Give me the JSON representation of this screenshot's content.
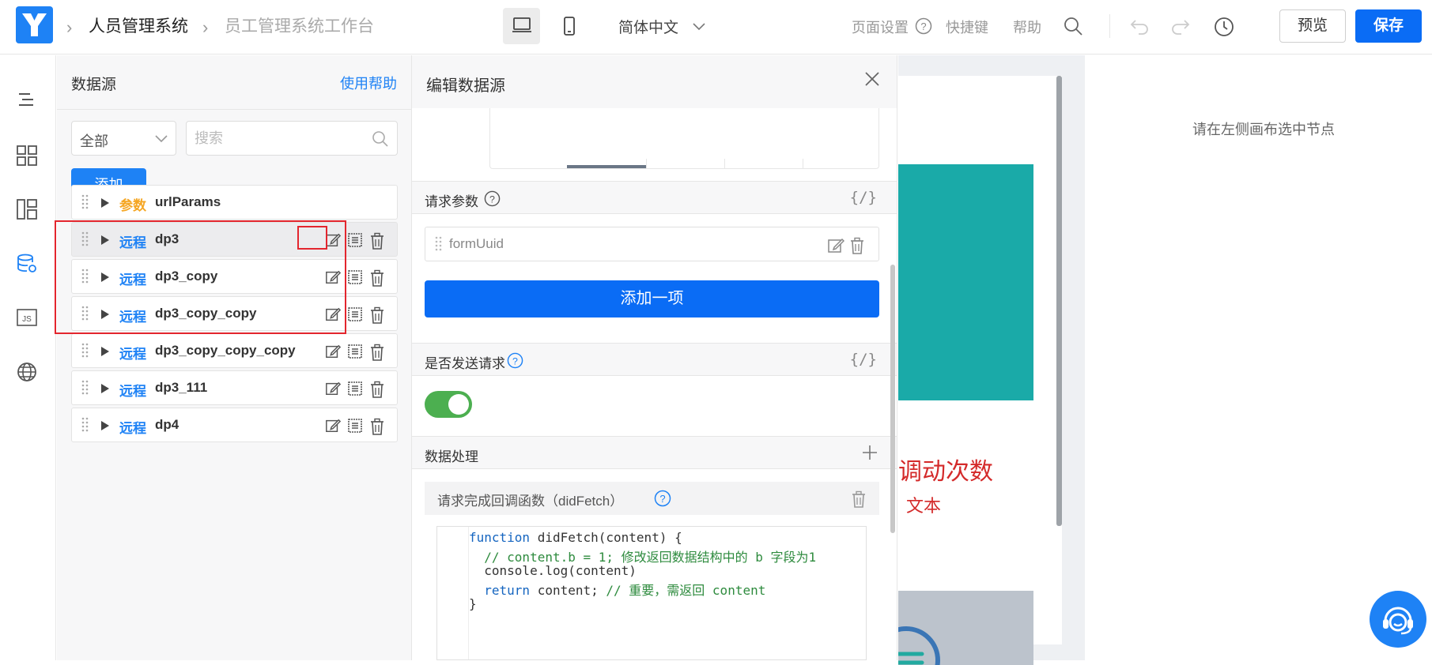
{
  "header": {
    "breadcrumb_app": "人员管理系统",
    "breadcrumb_page": "员工管理系统工作台",
    "language": "简体中文",
    "page_settings": "页面设置",
    "shortcuts": "快捷键",
    "help": "帮助",
    "preview_label": "预览",
    "save_label": "保存"
  },
  "rail": {
    "icons": [
      "outline-tree-icon",
      "components-grid-icon",
      "layout-icon",
      "datasource-icon",
      "js-code-icon",
      "globe-icon"
    ]
  },
  "datasource_panel": {
    "title": "数据源",
    "help_link": "使用帮助",
    "filter_value": "全部",
    "search_placeholder": "搜索",
    "add_label": "添加",
    "items": [
      {
        "kind": "参数",
        "name": "urlParams"
      },
      {
        "kind": "远程",
        "name": "dp3"
      },
      {
        "kind": "远程",
        "name": "dp3_copy"
      },
      {
        "kind": "远程",
        "name": "dp3_copy_copy"
      },
      {
        "kind": "远程",
        "name": "dp3_copy_copy_copy"
      },
      {
        "kind": "远程",
        "name": "dp3_111"
      },
      {
        "kind": "远程",
        "name": "dp4"
      }
    ]
  },
  "edit_panel": {
    "title": "编辑数据源",
    "request_params_title": "请求参数",
    "code_toggle": "{/}",
    "param_name": "formUuid",
    "add_item_label": "添加一项",
    "send_request_title": "是否发送请求",
    "send_request_enabled": true,
    "data_processing_title": "数据处理",
    "callback_title": "请求完成回调函数（didFetch）",
    "code_lines": [
      "function didFetch(content) {",
      "  // content.b = 1; 修改返回数据结构中的 b 字段为1",
      "  console.log(content)",
      "  return content; // 重要，需返回 content",
      "}"
    ]
  },
  "canvas": {
    "counter_text": "调动次数",
    "small_text": "文本"
  },
  "properties": {
    "hint": "请在左侧画布选中节点"
  },
  "colors": {
    "primary": "#0a6cf5",
    "link": "#1e82f5",
    "param_kind": "#f5a623",
    "teal": "#1aaaa8",
    "highlight_red": "#e3262e",
    "toggle_on": "#4caf50"
  }
}
